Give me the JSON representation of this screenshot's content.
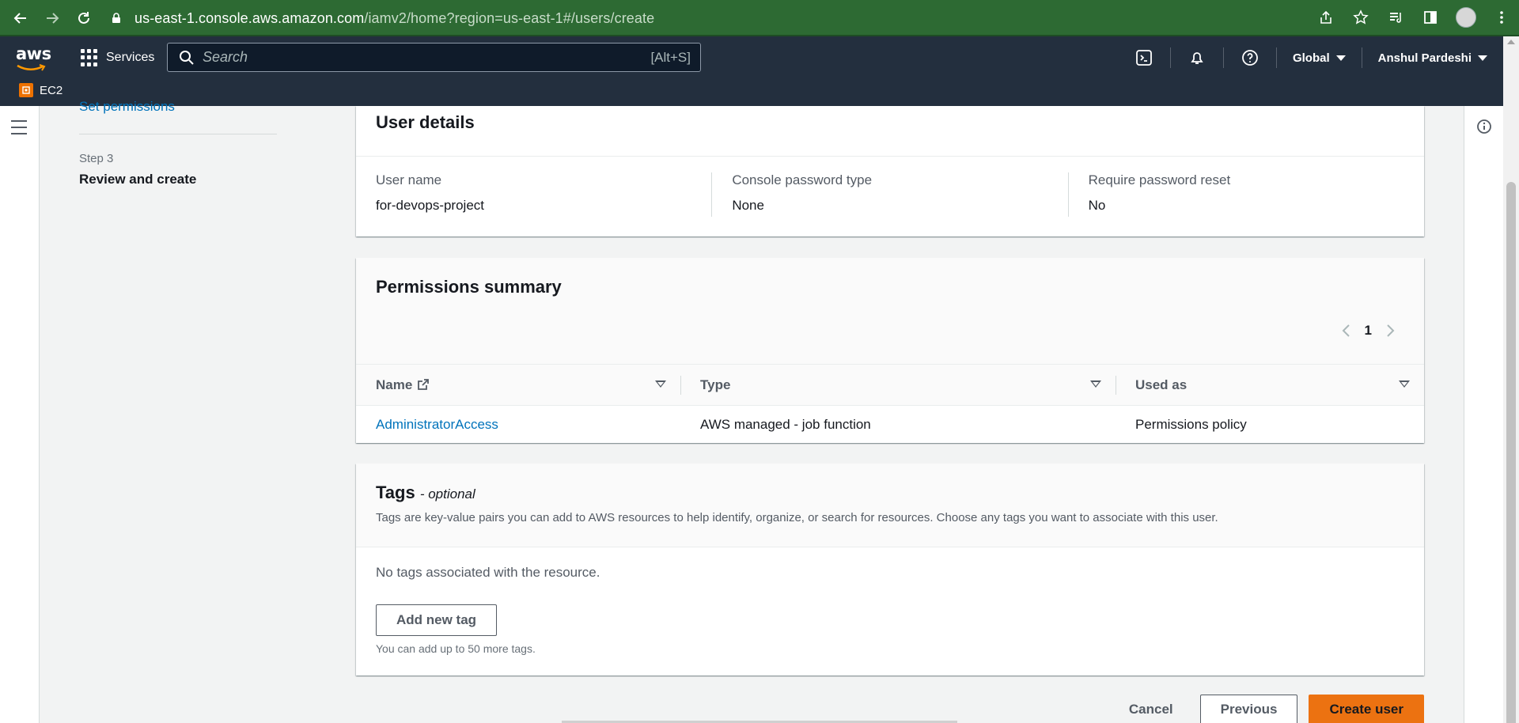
{
  "browser": {
    "url_host": "us-east-1.console.aws.amazon.com",
    "url_path": "/iamv2/home?region=us-east-1#/users/create"
  },
  "aws_nav": {
    "logo_text": "aws",
    "services_label": "Services",
    "search_placeholder": "Search",
    "search_shortcut": "[Alt+S]",
    "region_label": "Global",
    "user_label": "Anshul Pardeshi",
    "favorite_label": "EC2"
  },
  "steps": {
    "prev_step_link": "Set permissions",
    "step_label": "Step 3",
    "step_title": "Review and create"
  },
  "user_details": {
    "title": "User details",
    "fields": [
      {
        "key": "User name",
        "value": "for-devops-project"
      },
      {
        "key": "Console password type",
        "value": "None"
      },
      {
        "key": "Require password reset",
        "value": "No"
      }
    ]
  },
  "permissions": {
    "title": "Permissions summary",
    "page": "1",
    "columns": [
      "Name",
      "Type",
      "Used as"
    ],
    "rows": [
      {
        "name": "AdministratorAccess",
        "type": "AWS managed - job function",
        "used_as": "Permissions policy"
      }
    ]
  },
  "tags": {
    "title": "Tags",
    "optional": "- optional",
    "description": "Tags are key-value pairs you can add to AWS resources to help identify, organize, or search for resources. Choose any tags you want to associate with this user.",
    "empty_text": "No tags associated with the resource.",
    "add_button": "Add new tag",
    "hint": "You can add up to 50 more tags."
  },
  "actions": {
    "cancel": "Cancel",
    "previous": "Previous",
    "create": "Create user"
  },
  "colors": {
    "browser_bar": "#2d6a33",
    "aws_nav": "#232f3e",
    "primary": "#ec7211",
    "link": "#0073bb"
  }
}
